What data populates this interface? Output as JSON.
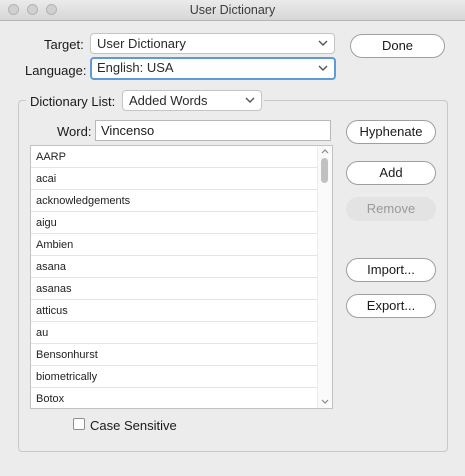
{
  "window": {
    "title": "User Dictionary"
  },
  "target": {
    "label": "Target:",
    "value": "User Dictionary"
  },
  "language": {
    "label": "Language:",
    "value": "English: USA"
  },
  "dictionary_list": {
    "label": "Dictionary List:",
    "value": "Added Words"
  },
  "word": {
    "label": "Word:",
    "value": "Vincenso"
  },
  "buttons": {
    "done": "Done",
    "hyphenate": "Hyphenate",
    "add": "Add",
    "remove": "Remove",
    "import": "Import...",
    "export": "Export..."
  },
  "words": [
    "AARP",
    "acai",
    "acknowledgements",
    "aigu",
    "Ambien",
    "asana",
    "asanas",
    "atticus",
    "au",
    "Bensonhurst",
    "biometrically",
    "Botox"
  ],
  "case_sensitive": {
    "label": "Case Sensitive",
    "checked": false
  },
  "icons": {
    "dropdown": "chevron-down-icon",
    "window_buttons": "window-control-icon"
  }
}
